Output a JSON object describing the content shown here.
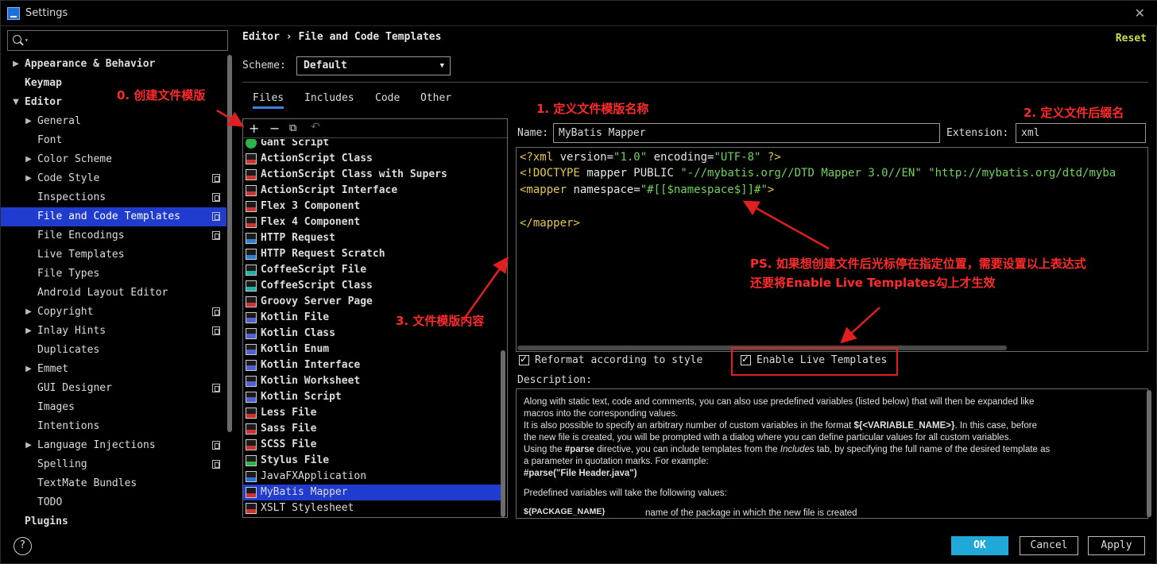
{
  "window": {
    "title": "Settings"
  },
  "search": {
    "placeholder": ""
  },
  "sidebar": {
    "items": [
      {
        "label": "Appearance & Behavior",
        "level": 0,
        "arrow": "▶",
        "bold": true
      },
      {
        "label": "Keymap",
        "level": 0,
        "arrow": "",
        "bold": true
      },
      {
        "label": "Editor",
        "level": 0,
        "arrow": "▼",
        "bold": true
      },
      {
        "label": "General",
        "level": 1,
        "arrow": "▶"
      },
      {
        "label": "Font",
        "level": 1,
        "arrow": ""
      },
      {
        "label": "Color Scheme",
        "level": 1,
        "arrow": "▶"
      },
      {
        "label": "Code Style",
        "level": 1,
        "arrow": "▶",
        "project": true
      },
      {
        "label": "Inspections",
        "level": 1,
        "arrow": "",
        "project": true
      },
      {
        "label": "File and Code Templates",
        "level": 1,
        "arrow": "",
        "project": true,
        "selected": true
      },
      {
        "label": "File Encodings",
        "level": 1,
        "arrow": "",
        "project": true
      },
      {
        "label": "Live Templates",
        "level": 1,
        "arrow": ""
      },
      {
        "label": "File Types",
        "level": 1,
        "arrow": ""
      },
      {
        "label": "Android Layout Editor",
        "level": 1,
        "arrow": ""
      },
      {
        "label": "Copyright",
        "level": 1,
        "arrow": "▶",
        "project": true
      },
      {
        "label": "Inlay Hints",
        "level": 1,
        "arrow": "▶",
        "project": true
      },
      {
        "label": "Duplicates",
        "level": 1,
        "arrow": ""
      },
      {
        "label": "Emmet",
        "level": 1,
        "arrow": "▶"
      },
      {
        "label": "GUI Designer",
        "level": 1,
        "arrow": "",
        "project": true
      },
      {
        "label": "Images",
        "level": 1,
        "arrow": ""
      },
      {
        "label": "Intentions",
        "level": 1,
        "arrow": ""
      },
      {
        "label": "Language Injections",
        "level": 1,
        "arrow": "▶",
        "project": true
      },
      {
        "label": "Spelling",
        "level": 1,
        "arrow": "",
        "project": true
      },
      {
        "label": "TextMate Bundles",
        "level": 1,
        "arrow": ""
      },
      {
        "label": "TODO",
        "level": 1,
        "arrow": ""
      },
      {
        "label": "Plugins",
        "level": 0,
        "arrow": "",
        "bold": true
      }
    ]
  },
  "header": {
    "breadcrumb": "Editor › File and Code Templates",
    "reset": "Reset",
    "scheme_label": "Scheme:",
    "scheme_value": "Default"
  },
  "tabs": [
    "Files",
    "Includes",
    "Code",
    "Other"
  ],
  "templates": [
    {
      "name": "Gant Script",
      "icon": "g"
    },
    {
      "name": "ActionScript Class",
      "icon": "r"
    },
    {
      "name": "ActionScript Class with Supers",
      "icon": "r"
    },
    {
      "name": "ActionScript Interface",
      "icon": "r"
    },
    {
      "name": "Flex 3 Component",
      "icon": "r"
    },
    {
      "name": "Flex 4 Component",
      "icon": "r"
    },
    {
      "name": "HTTP Request",
      "icon": "b"
    },
    {
      "name": "HTTP Request Scratch",
      "icon": "b"
    },
    {
      "name": "CoffeeScript File",
      "icon": "c"
    },
    {
      "name": "CoffeeScript Class",
      "icon": "c"
    },
    {
      "name": "Groovy Server Page",
      "icon": "r"
    },
    {
      "name": "Kotlin File",
      "icon": "k"
    },
    {
      "name": "Kotlin Class",
      "icon": "k"
    },
    {
      "name": "Kotlin Enum",
      "icon": "k"
    },
    {
      "name": "Kotlin Interface",
      "icon": "k"
    },
    {
      "name": "Kotlin Worksheet",
      "icon": "k"
    },
    {
      "name": "Kotlin Script",
      "icon": "k"
    },
    {
      "name": "Less File",
      "icon": "r"
    },
    {
      "name": "Sass File",
      "icon": "r"
    },
    {
      "name": "SCSS File",
      "icon": "r"
    },
    {
      "name": "Stylus File",
      "icon": "y"
    },
    {
      "name": "JavaFXApplication",
      "icon": "f",
      "normal": true
    },
    {
      "name": "MyBatis Mapper",
      "icon": "r",
      "selected": true
    },
    {
      "name": "XSLT Stylesheet",
      "icon": "r",
      "normal": true
    }
  ],
  "form": {
    "name_label": "Name:",
    "name_value": "MyBatis Mapper",
    "extension_label": "Extension:",
    "extension_value": "xml"
  },
  "code": {
    "line1": {
      "a": "<?xml ",
      "b": "version=",
      "c": "\"1.0\"",
      "d": " encoding=",
      "e": "\"UTF-8\"",
      "f": " ?>"
    },
    "line2": {
      "a": "<!DOCTYPE ",
      "b": "mapper PUBLIC ",
      "c": "\"-//mybatis.org//DTD Mapper 3.0//EN\"",
      "d": " ",
      "e": "\"http://mybatis.org/dtd/myba"
    },
    "line3": {
      "a": "<mapper ",
      "b": "namespace=",
      "c": "\"#[[$namespace$]]#\"",
      "d": ">"
    },
    "line4": {
      "a": "</mapper>"
    }
  },
  "options": {
    "reformat": "Reformat according to style",
    "live_templates": "Enable Live Templates"
  },
  "description": {
    "label": "Description:",
    "l1": "Along with static text, code and comments, you can also use predefined variables (listed below) that will then be expanded like",
    "l2": "macros into the corresponding values.",
    "l3a": "It is also possible to specify an arbitrary number of custom variables in the format ",
    "l3b": "${<VARIABLE_NAME>}",
    "l3c": ". In this case, before",
    "l4": "the new file is created, you will be prompted with a dialog where you can define particular values for all custom variables.",
    "l5a": "Using the ",
    "l5b": "#parse",
    "l5c": " directive, you can include templates from the ",
    "l5d": "Includes",
    "l5e": " tab, by specifying the full name of the desired template as",
    "l6": "a parameter in quotation marks. For example:",
    "l7": "#parse(\"File Header.java\")",
    "l8": "Predefined variables will take the following values:",
    "var_name": "${PACKAGE_NAME}",
    "var_desc": "name of the package in which the new file is created"
  },
  "footer": {
    "help": "?",
    "ok": "OK",
    "cancel": "Cancel",
    "apply": "Apply"
  },
  "annotations": {
    "a0": "0. 创建文件模版",
    "a1": "1. 定义文件模版名称",
    "a2": "2. 定义文件后缀名",
    "a3": "3. 文件模版内容",
    "ps1": "PS. 如果想创建文件后光标停在指定位置，需要设置以上表达式",
    "ps2": "还要将Enable Live Templates勾上才生效"
  },
  "colors": {
    "accent": "#1f3ccf",
    "ok_button": "#1fa8d8",
    "annotation": "#ff2a2a",
    "keyword": "#e6c84a",
    "string": "#6fd35a",
    "reset": "#c8e04a"
  }
}
